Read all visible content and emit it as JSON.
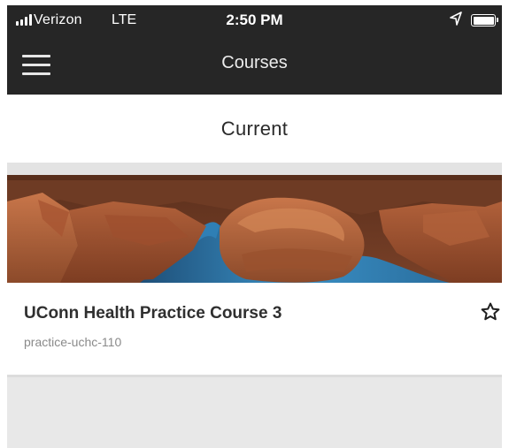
{
  "status_bar": {
    "carrier": "Verizon",
    "network": "LTE",
    "time": "2:50 PM",
    "location_icon": "location-arrow-icon",
    "battery_icon": "battery-full-icon",
    "signal_icon": "signal-bars-icon"
  },
  "nav": {
    "title": "Courses",
    "menu_icon": "hamburger-menu-icon"
  },
  "section": {
    "heading": "Current"
  },
  "courses": [
    {
      "title": "UConn Health Practice Course 3",
      "code": "practice-uchc-110",
      "favorite_icon": "star-outline-icon",
      "is_favorite": false
    }
  ],
  "colors": {
    "nav_bar": "#262626",
    "section_divider": "#e3e3e3",
    "title_text": "#2f2f2f",
    "subtitle_text": "#8a8a8a"
  }
}
